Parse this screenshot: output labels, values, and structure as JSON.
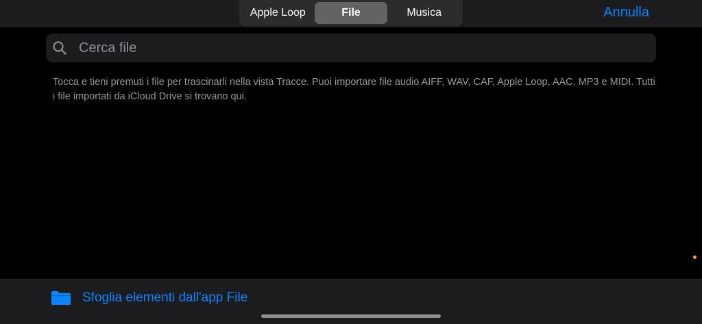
{
  "segments": [
    {
      "label": "Apple Loop",
      "selected": false
    },
    {
      "label": "File",
      "selected": true
    },
    {
      "label": "Musica",
      "selected": false
    }
  ],
  "cancel_label": "Annulla",
  "search": {
    "placeholder": "Cerca file",
    "value": "",
    "icon": "search-icon"
  },
  "info_text": "Tocca e tieni premuti i file per trascinarli nella vista Tracce. Puoi importare file audio AIFF, WAV, CAF, Apple Loop, AAC, MP3 e MIDI. Tutti i file importati da iCloud Drive si trovano qui.",
  "browse": {
    "label": "Sfoglia elementi dall'app File",
    "icon": "folder-icon"
  },
  "colors": {
    "accent": "#0a84ff",
    "background": "#000000",
    "bar": "#1c1c1e",
    "indicator_dot": "#ff9f0a"
  }
}
